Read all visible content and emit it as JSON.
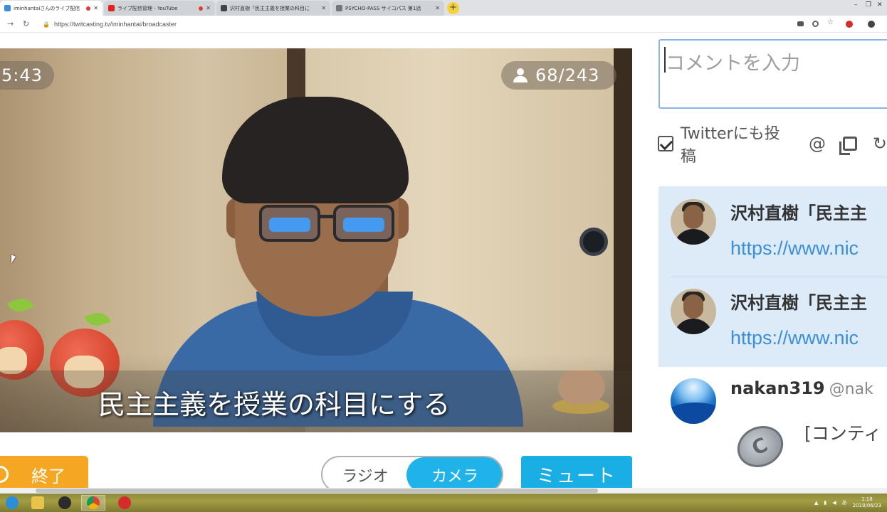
{
  "browser": {
    "tabs": [
      {
        "title": "iminhantaiさんのライブ配信",
        "active": true,
        "favicon_color": "#3a8fd8",
        "recording": true
      },
      {
        "title": "ライブ配信管理 - YouTube",
        "active": false,
        "favicon_color": "#e62117",
        "recording": true
      },
      {
        "title": "沢村直樹「民主主義を授業の科目に",
        "active": false,
        "favicon_color": "#444444",
        "recording": false
      },
      {
        "title": "PSYCHO-PASS サイコパス 第1話",
        "active": false,
        "favicon_color": "#777777",
        "recording": false
      }
    ],
    "url": "https://twitcasting.tv/iminhantai/broadcaster"
  },
  "video": {
    "elapsed": "5:43",
    "viewers": "68/243",
    "telop": "民主主義を授業の科目にする"
  },
  "controls": {
    "end_label": "終了",
    "radio_label": "ラジオ",
    "camera_label": "カメラ",
    "mute_label": "ミュート"
  },
  "comment_panel": {
    "input_placeholder": "コメントを入力",
    "twitter_label": "Twitterにも投稿",
    "twitter_checked": true,
    "at_symbol": "@",
    "comments": [
      {
        "name": "沢村直樹「民主主",
        "link": "https://www.nic",
        "highlighted": true
      },
      {
        "name": "沢村直樹「民主主",
        "link": "https://www.nic",
        "highlighted": true
      },
      {
        "name": "nakan319",
        "handle": "@nak",
        "text": "[コンティ",
        "highlighted": false
      }
    ]
  },
  "taskbar": {
    "time": "1:18",
    "date": "2019/06/23"
  },
  "colors": {
    "accent_blue": "#1fb3e9",
    "end_orange": "#f5a623",
    "link_blue": "#3b8fd6",
    "highlight_bg": "#ddeaf7"
  }
}
